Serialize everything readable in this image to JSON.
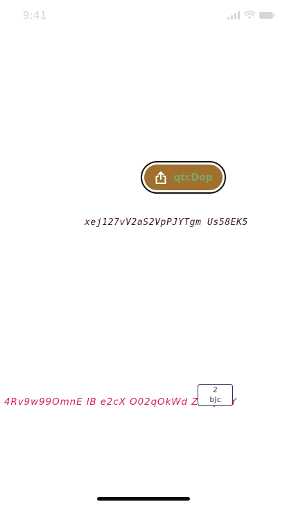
{
  "status_bar": {
    "time": "9:41",
    "icons": [
      "signal-icon",
      "wifi-icon",
      "battery-icon"
    ]
  },
  "share_button": {
    "icon": "share-icon",
    "label": "qtcDop",
    "colors": {
      "fill": "#a0702f",
      "label": "#80a368",
      "border": "#111111"
    }
  },
  "mono_text": "xej127vV2aS2VpPJYTgm Us58EK5",
  "pink_text": "4Rv9w99OmnE lB e2cX O02qOkWd          ZKmJ2cY",
  "mini_box": {
    "top": "2",
    "bottom": "bJc"
  }
}
